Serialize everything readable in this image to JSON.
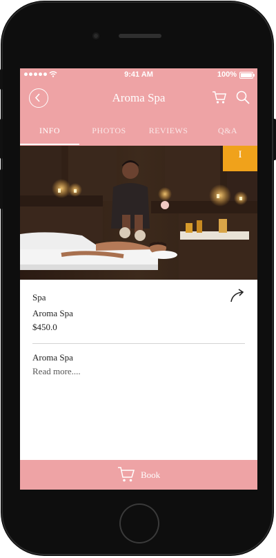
{
  "status_bar": {
    "time": "9:41 AM",
    "battery_text": "100%",
    "battery_level": 1.0
  },
  "header": {
    "title": "Aroma Spa",
    "back_icon": "chevron-left-icon",
    "cart_icon": "cart-icon",
    "search_icon": "search-icon",
    "background_color": "#eea3a5"
  },
  "tabs": [
    {
      "label": "INFO",
      "active": true
    },
    {
      "label": "PHOTOS",
      "active": false
    },
    {
      "label": "REVIEWS",
      "active": false
    },
    {
      "label": "Q&A",
      "active": false
    }
  ],
  "hero": {
    "badge": "I",
    "badge_color": "#f0a21b"
  },
  "details": {
    "category": "Spa",
    "name": "Aroma Spa",
    "price": "$450.0",
    "share_icon": "share-arrow-icon"
  },
  "description": {
    "title": "Aroma Spa",
    "read_more": "Read more...."
  },
  "book": {
    "label": "Book",
    "icon": "cart-icon"
  }
}
